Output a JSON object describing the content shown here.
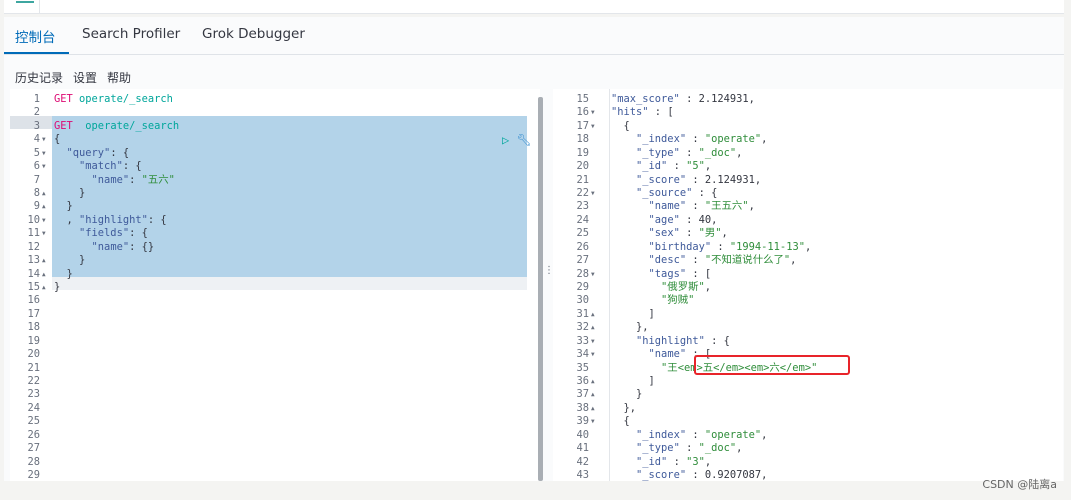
{
  "tabs": [
    {
      "label": "控制台",
      "active": true
    },
    {
      "label": "Search Profiler"
    },
    {
      "label": "Grok Debugger"
    }
  ],
  "toolbar": {
    "history": "历史记录",
    "settings": "设置",
    "help": "帮助"
  },
  "icons": {
    "run": "play-icon",
    "wrench": "wrench-icon",
    "divider": "vertical-dots-icon"
  },
  "colors": {
    "accent": "#006bb8",
    "selection": "#b3d3e9",
    "highlight_box": "#e8242a"
  },
  "left_editor": {
    "selected_lines": [
      3,
      14
    ],
    "active_line": 15,
    "lines": [
      {
        "n": "1",
        "t": [
          [
            "method",
            "GET"
          ],
          [
            "p",
            " "
          ],
          [
            "url",
            "operate/_search"
          ]
        ]
      },
      {
        "n": "2",
        "t": []
      },
      {
        "n": "3",
        "t": [
          [
            "method",
            "GET"
          ],
          [
            "p",
            "  "
          ],
          [
            "url",
            "operate/_search"
          ]
        ]
      },
      {
        "n": "4",
        "f": "▼",
        "t": [
          [
            "p",
            "{"
          ]
        ]
      },
      {
        "n": "5",
        "f": "▼",
        "t": [
          [
            "p",
            "  "
          ],
          [
            "key",
            "\"query\""
          ],
          [
            "p",
            ": {"
          ]
        ]
      },
      {
        "n": "6",
        "f": "▼",
        "t": [
          [
            "p",
            "    "
          ],
          [
            "key",
            "\"match\""
          ],
          [
            "p",
            ": {"
          ]
        ]
      },
      {
        "n": "7",
        "t": [
          [
            "p",
            "      "
          ],
          [
            "key",
            "\"name\""
          ],
          [
            "p",
            ": "
          ],
          [
            "str",
            "\"五六\""
          ]
        ]
      },
      {
        "n": "8",
        "f": "▲",
        "t": [
          [
            "p",
            "    }"
          ]
        ]
      },
      {
        "n": "9",
        "f": "▲",
        "t": [
          [
            "p",
            "  }"
          ]
        ]
      },
      {
        "n": "10",
        "f": "▼",
        "t": [
          [
            "p",
            "  , "
          ],
          [
            "key",
            "\"highlight\""
          ],
          [
            "p",
            ": {"
          ]
        ]
      },
      {
        "n": "11",
        "f": "▼",
        "t": [
          [
            "p",
            "    "
          ],
          [
            "key",
            "\"fields\""
          ],
          [
            "p",
            ": {"
          ]
        ]
      },
      {
        "n": "12",
        "t": [
          [
            "p",
            "      "
          ],
          [
            "key",
            "\"name\""
          ],
          [
            "p",
            ": {}"
          ]
        ]
      },
      {
        "n": "13",
        "f": "▲",
        "t": [
          [
            "p",
            "    }"
          ]
        ]
      },
      {
        "n": "14",
        "f": "▲",
        "t": [
          [
            "p",
            "  }"
          ]
        ]
      },
      {
        "n": "15",
        "f": "▲",
        "t": [
          [
            "p",
            "}"
          ]
        ]
      },
      {
        "n": "16",
        "t": []
      },
      {
        "n": "17",
        "t": []
      },
      {
        "n": "18",
        "t": []
      },
      {
        "n": "19",
        "t": []
      },
      {
        "n": "20",
        "t": []
      },
      {
        "n": "21",
        "t": []
      },
      {
        "n": "22",
        "t": []
      },
      {
        "n": "23",
        "t": []
      },
      {
        "n": "24",
        "t": []
      },
      {
        "n": "25",
        "t": []
      },
      {
        "n": "26",
        "t": []
      },
      {
        "n": "27",
        "t": []
      },
      {
        "n": "28",
        "t": []
      },
      {
        "n": "29",
        "t": []
      }
    ]
  },
  "right_editor": {
    "lines": [
      {
        "n": "15",
        "t": [
          [
            "key",
            "\"max_score\""
          ],
          [
            "p",
            " : "
          ],
          [
            "num",
            "2.124931"
          ],
          [
            "p",
            ","
          ]
        ]
      },
      {
        "n": "16",
        "f": "▼",
        "t": [
          [
            "key",
            "\"hits\""
          ],
          [
            "p",
            " : ["
          ]
        ]
      },
      {
        "n": "17",
        "f": "▼",
        "t": [
          [
            "p",
            "  {"
          ]
        ]
      },
      {
        "n": "18",
        "t": [
          [
            "p",
            "    "
          ],
          [
            "key",
            "\"_index\""
          ],
          [
            "p",
            " : "
          ],
          [
            "str",
            "\"operate\""
          ],
          [
            "p",
            ","
          ]
        ]
      },
      {
        "n": "19",
        "t": [
          [
            "p",
            "    "
          ],
          [
            "key",
            "\"_type\""
          ],
          [
            "p",
            " : "
          ],
          [
            "str",
            "\"_doc\""
          ],
          [
            "p",
            ","
          ]
        ]
      },
      {
        "n": "20",
        "t": [
          [
            "p",
            "    "
          ],
          [
            "key",
            "\"_id\""
          ],
          [
            "p",
            " : "
          ],
          [
            "str",
            "\"5\""
          ],
          [
            "p",
            ","
          ]
        ]
      },
      {
        "n": "21",
        "t": [
          [
            "p",
            "    "
          ],
          [
            "key",
            "\"_score\""
          ],
          [
            "p",
            " : "
          ],
          [
            "num",
            "2.124931"
          ],
          [
            "p",
            ","
          ]
        ]
      },
      {
        "n": "22",
        "f": "▼",
        "t": [
          [
            "p",
            "    "
          ],
          [
            "key",
            "\"_source\""
          ],
          [
            "p",
            " : {"
          ]
        ]
      },
      {
        "n": "23",
        "t": [
          [
            "p",
            "      "
          ],
          [
            "key",
            "\"name\""
          ],
          [
            "p",
            " : "
          ],
          [
            "str",
            "\"王五六\""
          ],
          [
            "p",
            ","
          ]
        ]
      },
      {
        "n": "24",
        "t": [
          [
            "p",
            "      "
          ],
          [
            "key",
            "\"age\""
          ],
          [
            "p",
            " : "
          ],
          [
            "num",
            "40"
          ],
          [
            "p",
            ","
          ]
        ]
      },
      {
        "n": "25",
        "t": [
          [
            "p",
            "      "
          ],
          [
            "key",
            "\"sex\""
          ],
          [
            "p",
            " : "
          ],
          [
            "str",
            "\"男\""
          ],
          [
            "p",
            ","
          ]
        ]
      },
      {
        "n": "26",
        "t": [
          [
            "p",
            "      "
          ],
          [
            "key",
            "\"birthday\""
          ],
          [
            "p",
            " : "
          ],
          [
            "str",
            "\"1994-11-13\""
          ],
          [
            "p",
            ","
          ]
        ]
      },
      {
        "n": "27",
        "t": [
          [
            "p",
            "      "
          ],
          [
            "key",
            "\"desc\""
          ],
          [
            "p",
            " : "
          ],
          [
            "str",
            "\"不知道说什么了\""
          ],
          [
            "p",
            ","
          ]
        ]
      },
      {
        "n": "28",
        "f": "▼",
        "t": [
          [
            "p",
            "      "
          ],
          [
            "key",
            "\"tags\""
          ],
          [
            "p",
            " : ["
          ]
        ]
      },
      {
        "n": "29",
        "t": [
          [
            "p",
            "        "
          ],
          [
            "str",
            "\"俄罗斯\""
          ],
          [
            "p",
            ","
          ]
        ]
      },
      {
        "n": "30",
        "t": [
          [
            "p",
            "        "
          ],
          [
            "str",
            "\"狗贼\""
          ]
        ]
      },
      {
        "n": "31",
        "f": "▲",
        "t": [
          [
            "p",
            "      ]"
          ]
        ]
      },
      {
        "n": "32",
        "f": "▲",
        "t": [
          [
            "p",
            "    },"
          ]
        ]
      },
      {
        "n": "33",
        "f": "▼",
        "t": [
          [
            "p",
            "    "
          ],
          [
            "key",
            "\"highlight\""
          ],
          [
            "p",
            " : {"
          ]
        ]
      },
      {
        "n": "34",
        "f": "▼",
        "t": [
          [
            "p",
            "      "
          ],
          [
            "key",
            "\"name\""
          ],
          [
            "p",
            " : ["
          ]
        ]
      },
      {
        "n": "35",
        "t": [
          [
            "p",
            "        "
          ],
          [
            "str",
            "\"王<em>五</em><em>六</em>\""
          ]
        ]
      },
      {
        "n": "36",
        "f": "▲",
        "t": [
          [
            "p",
            "      ]"
          ]
        ]
      },
      {
        "n": "37",
        "f": "▲",
        "t": [
          [
            "p",
            "    }"
          ]
        ]
      },
      {
        "n": "38",
        "f": "▲",
        "t": [
          [
            "p",
            "  },"
          ]
        ]
      },
      {
        "n": "39",
        "f": "▼",
        "t": [
          [
            "p",
            "  {"
          ]
        ]
      },
      {
        "n": "40",
        "t": [
          [
            "p",
            "    "
          ],
          [
            "key",
            "\"_index\""
          ],
          [
            "p",
            " : "
          ],
          [
            "str",
            "\"operate\""
          ],
          [
            "p",
            ","
          ]
        ]
      },
      {
        "n": "41",
        "t": [
          [
            "p",
            "    "
          ],
          [
            "key",
            "\"_type\""
          ],
          [
            "p",
            " : "
          ],
          [
            "str",
            "\"_doc\""
          ],
          [
            "p",
            ","
          ]
        ]
      },
      {
        "n": "42",
        "t": [
          [
            "p",
            "    "
          ],
          [
            "key",
            "\"_id\""
          ],
          [
            "p",
            " : "
          ],
          [
            "str",
            "\"3\""
          ],
          [
            "p",
            ","
          ]
        ]
      },
      {
        "n": "43",
        "t": [
          [
            "p",
            "    "
          ],
          [
            "key",
            "\"_score\""
          ],
          [
            "p",
            " : "
          ],
          [
            "num",
            "0.9207087"
          ],
          [
            "p",
            ","
          ]
        ]
      }
    ]
  },
  "watermark": "CSDN @陆离a"
}
